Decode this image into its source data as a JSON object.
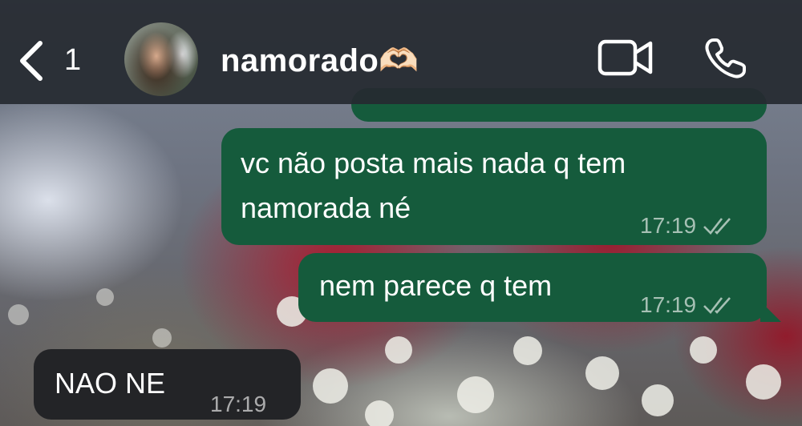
{
  "header": {
    "back_count": "1",
    "contact_name": "namorado🫶🏻"
  },
  "messages": [
    {
      "direction": "outgoing",
      "lines": [
        "vc não posta mais nada q tem",
        "namorada né"
      ],
      "time": "17:19",
      "status_icon": "double-check-icon"
    },
    {
      "direction": "outgoing",
      "lines": [
        "nem parece q tem"
      ],
      "time": "17:19",
      "status_icon": "double-check-icon"
    },
    {
      "direction": "incoming",
      "lines": [
        "NAO NE"
      ],
      "time": "17:19"
    }
  ],
  "colors": {
    "header_bg": "#262a30",
    "outgoing_bubble": "#155b3c",
    "incoming_bubble": "#232427",
    "text": "#ffffff"
  }
}
